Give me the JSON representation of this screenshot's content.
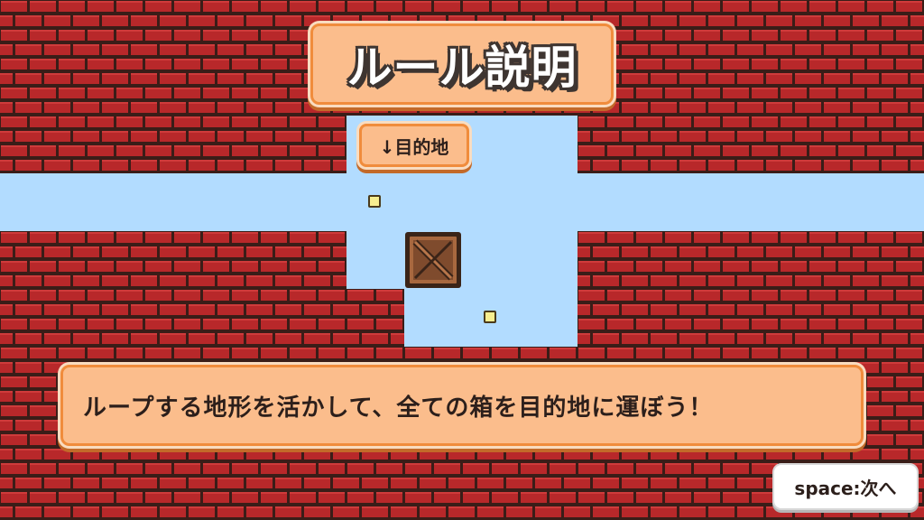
{
  "title": "ルール説明",
  "goal_label": "↓目的地",
  "message": "ループする地形を活かして、全ての箱を目的地に運ぼう！",
  "next_hint": "space:次へ",
  "colors": {
    "brick": "#b8282a",
    "mortar": "#3a1d18",
    "floor": "#b2dcff",
    "panel": "#fbbd8c",
    "panel_border": "#f08c3c",
    "goal": "#f7ee8f",
    "crate": "#9a5b3a"
  },
  "icons": {
    "crate": "wooden-crate-icon",
    "goal": "goal-marker-icon"
  }
}
